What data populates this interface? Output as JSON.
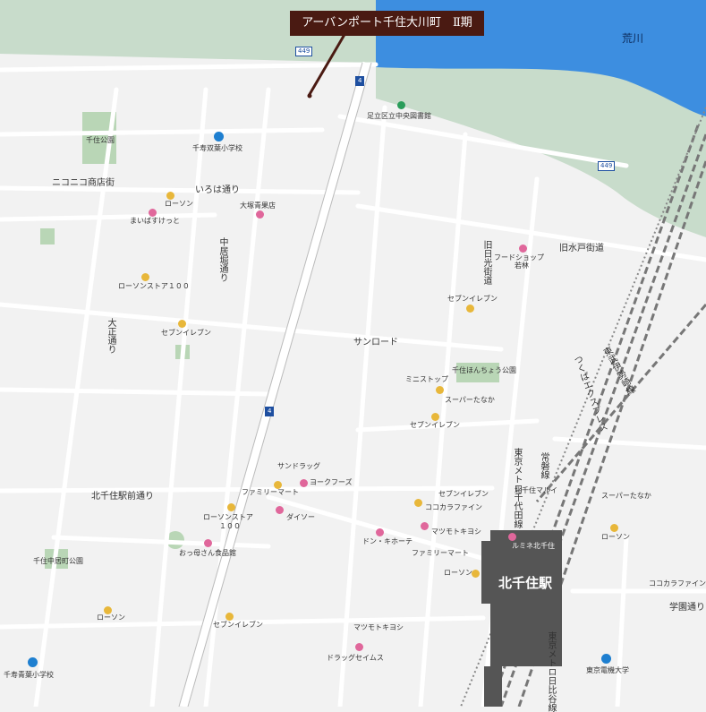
{
  "title": "アーバンポート千住大川町　Ⅱ期",
  "river": "荒川",
  "station": "北千住駅",
  "colors": {
    "river": "#3d8ee0",
    "bank": "#c8dccb",
    "road": "#ffffff",
    "station": "#555555",
    "title_bg": "#4a1a12"
  },
  "route_shields": [
    "449",
    "4",
    "4",
    "449"
  ],
  "landmarks": {
    "library": "足立区立中央図書館",
    "senju_park": "千住公園",
    "school1": "千寿双葉小学校",
    "school2": "千寿青葉小学校",
    "nikoniko": "ニコニコ商店街",
    "irohadori": "いろは通り",
    "lawson1": "ローソン",
    "maibasu": "まいばすけっと",
    "otsuka": "大塚青果店",
    "nakaihori": "中居堀通り",
    "lawson100a": "ローソンストア１００",
    "taishodori": "大正通り",
    "seven1": "セブンイレブン",
    "sunroad": "サンロード",
    "kyunikko": "旧日光街道",
    "foodshop": "フードショップ",
    "wakabayashi": "若林",
    "kyumito": "旧水戸街道",
    "seven2": "セブンイレブン",
    "hanchou_park": "千住ほんちょう公園",
    "ministop": "ミニストップ",
    "supertanaka1": "スーパーたなか",
    "seven3": "セブンイレブン",
    "tsukuba": "つくばエクスプレス",
    "tobu": "東武伊勢崎線",
    "joban": "常磐線",
    "chiyoda": "東京メトロ千代田線",
    "sundrug": "サンドラッグ",
    "yorks": "ヨークフーズ",
    "familymart1": "ファミリーマート",
    "kitasenju_ekimae": "北千住駅前通り",
    "daiso": "ダイソー",
    "lawson100b": "ローソンストア",
    "lawson100b2": "１００",
    "seven4": "セブンイレブン",
    "cocokara1": "ココカラファイン",
    "matsukiyo1": "マツモトキヨシ",
    "donki": "ドン・キホーテ",
    "familymart2": "ファミリーマート",
    "lawson2": "ローソン",
    "marui": "北千住マルイ",
    "lumine": "ルミネ北千住",
    "supertanaka2": "スーパーたなか",
    "lawson3": "ローソン",
    "cocokara2": "ココカラファイン",
    "gakuen": "学園通り",
    "senju_nakai_park": "千住中居町公園",
    "okkasan": "おっ母さん食品館",
    "lawson4": "ローソン",
    "seven5": "セブンイレブン",
    "matsukiyo2": "マツモトキヨシ",
    "drugseims": "ドラッグセイムス",
    "hibiya": "東京メトロ日比谷線",
    "denki_univ": "東京電機大学"
  }
}
